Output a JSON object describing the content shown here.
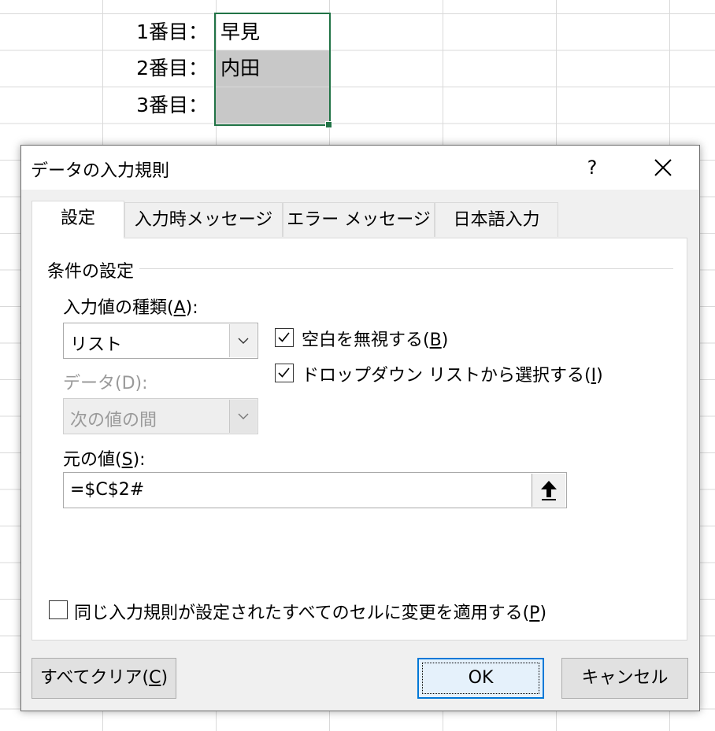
{
  "sheet": {
    "rows": [
      {
        "label": "1番目：",
        "value": "早見"
      },
      {
        "label": "2番目：",
        "value": "内田"
      },
      {
        "label": "3番目：",
        "value": ""
      }
    ]
  },
  "dialog": {
    "title": "データの入力規則",
    "help": "?",
    "tabs": [
      "設定",
      "入力時メッセージ",
      "エラー メッセージ",
      "日本語入力"
    ],
    "section_title": "条件の設定",
    "allow": {
      "label_pre": "入力値の種類(",
      "key": "A",
      "label_post": "):",
      "value": "リスト"
    },
    "data": {
      "label": "データ(D):",
      "value": "次の値の間"
    },
    "ignore_blank": {
      "label_pre": "空白を無視する(",
      "key": "B",
      "label_post": ")",
      "checked": true
    },
    "in_cell_dropdown": {
      "label_pre": "ドロップダウン リストから選択する(",
      "key": "I",
      "label_post": ")",
      "checked": true
    },
    "source": {
      "label_pre": "元の値(",
      "key": "S",
      "label_post": "):",
      "value": "=$C$2#"
    },
    "apply_all": {
      "label_pre": "同じ入力規則が設定されたすべてのセルに変更を適用する(",
      "key": "P",
      "label_post": ")",
      "checked": false
    },
    "clear_all": {
      "label_pre": "すべてクリア(",
      "key": "C",
      "label_post": ")"
    },
    "ok": "OK",
    "cancel": "キャンセル"
  }
}
